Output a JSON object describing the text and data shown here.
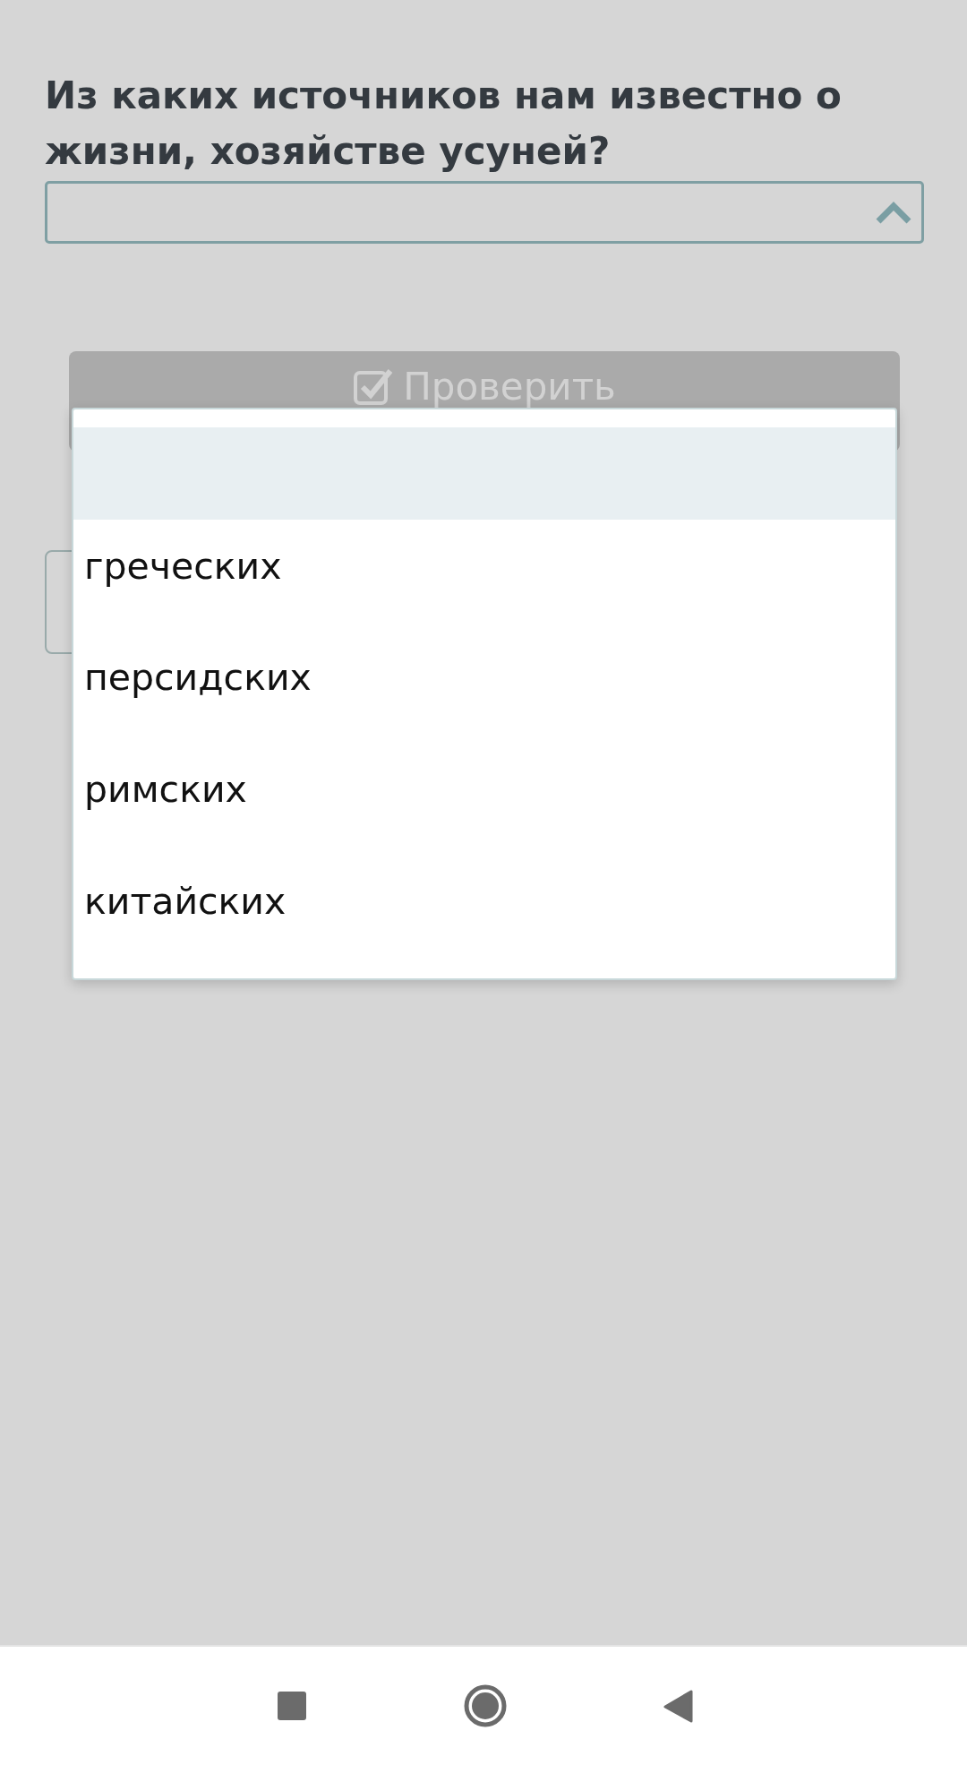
{
  "question": {
    "text": "Из каких источников нам известно о жизни, хозяйстве усуней?"
  },
  "select": {
    "expanded": true,
    "options": [
      {
        "selected": true
      },
      {
        "label": "греческих",
        "selected": false
      },
      {
        "label": "персидских",
        "selected": false
      },
      {
        "label": "римских",
        "selected": false
      },
      {
        "label": "китайских",
        "selected": false
      }
    ]
  },
  "check_button": {
    "label": "Проверить",
    "disabled": true
  },
  "nav_bar": {
    "buttons": [
      {
        "kind": "recents"
      },
      {
        "kind": "home"
      },
      {
        "kind": "back"
      }
    ]
  }
}
